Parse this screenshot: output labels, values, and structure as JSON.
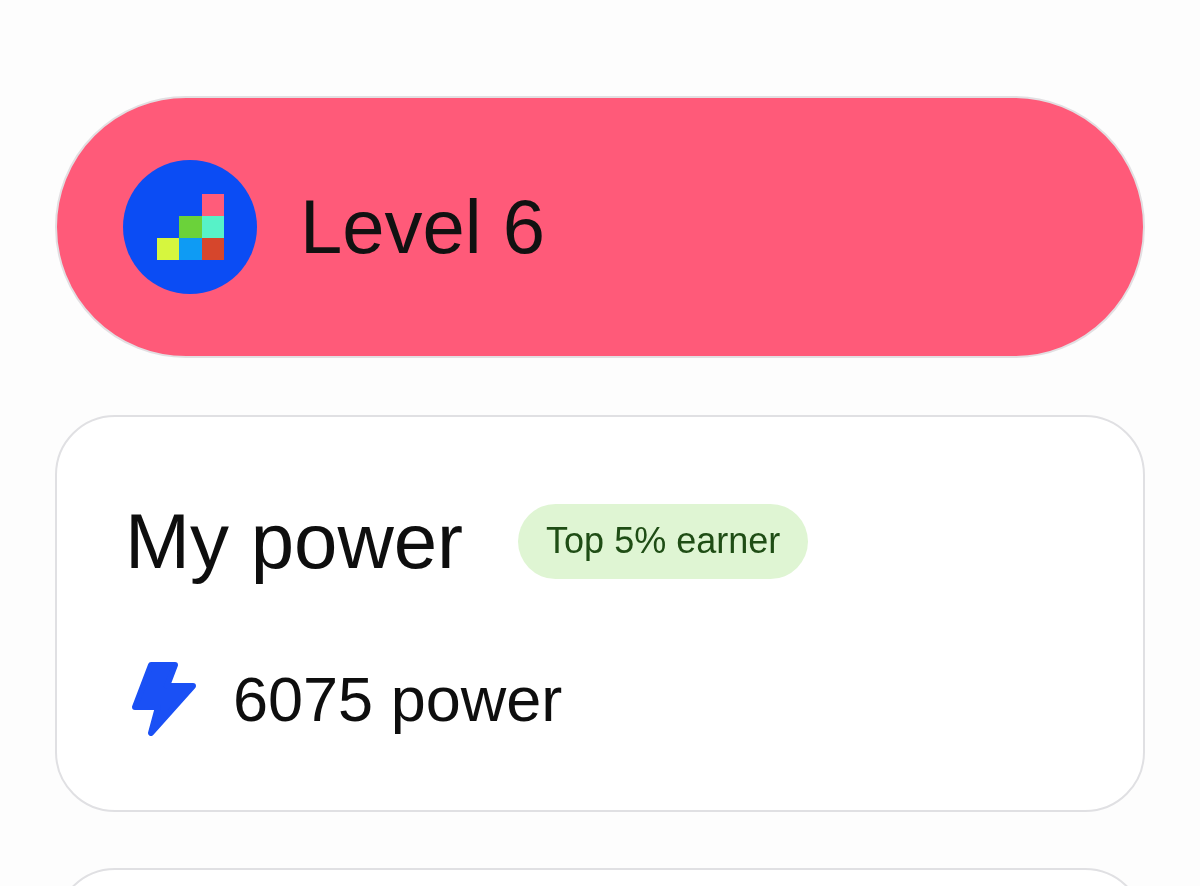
{
  "level_card": {
    "title": "Level 6"
  },
  "power_card": {
    "title": "My power",
    "badge": "Top 5% earner",
    "power": "6075 power"
  }
}
